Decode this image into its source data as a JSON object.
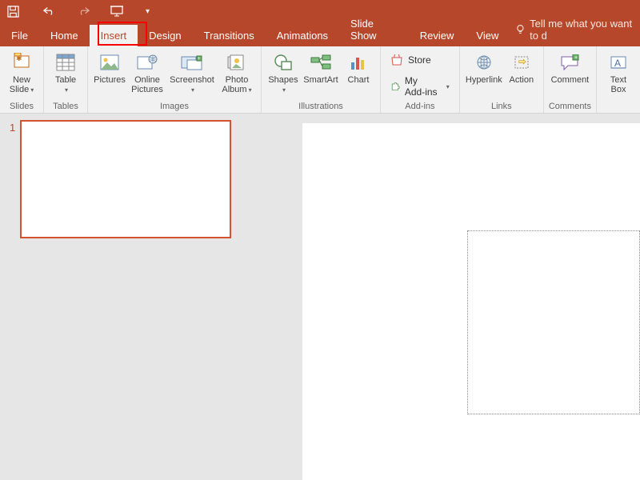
{
  "titlebar": {
    "icons": [
      "save",
      "undo",
      "redo",
      "start-from-beginning"
    ]
  },
  "tabs": {
    "file": "File",
    "home": "Home",
    "insert": "Insert",
    "design": "Design",
    "transitions": "Transitions",
    "animations": "Animations",
    "slideshow": "Slide Show",
    "review": "Review",
    "view": "View",
    "tellme": "Tell me what you want to d",
    "active": "insert",
    "highlighted": "insert"
  },
  "ribbon": {
    "groups": {
      "slides": {
        "label": "Slides",
        "new_slide": "New\nSlide"
      },
      "tables": {
        "label": "Tables",
        "table": "Table"
      },
      "images": {
        "label": "Images",
        "pictures": "Pictures",
        "online_pictures": "Online\nPictures",
        "screenshot": "Screenshot",
        "photo_album": "Photo\nAlbum"
      },
      "illustrations": {
        "label": "Illustrations",
        "shapes": "Shapes",
        "smartart": "SmartArt",
        "chart": "Chart"
      },
      "addins": {
        "label": "Add-ins",
        "store": "Store",
        "my_addins": "My Add-ins"
      },
      "links": {
        "label": "Links",
        "hyperlink": "Hyperlink",
        "action": "Action"
      },
      "comments": {
        "label": "Comments",
        "comment": "Comment"
      },
      "text": {
        "text_box": "Text\nBox"
      }
    }
  },
  "thumbnails": {
    "slides": [
      {
        "number": "1"
      }
    ]
  },
  "colors": {
    "brand": "#b7472a",
    "ribbon_bg": "#f1f1f1",
    "workspace_bg": "#e6e6e6",
    "highlight": "#ff0000"
  }
}
